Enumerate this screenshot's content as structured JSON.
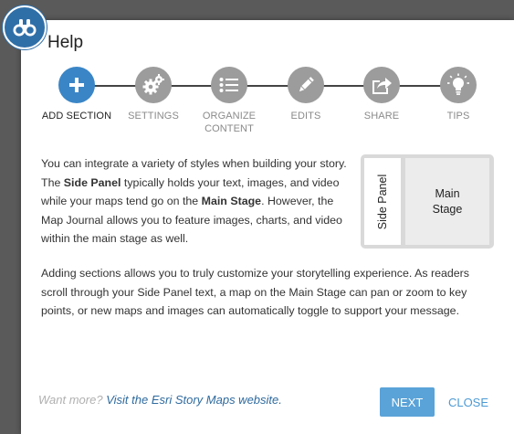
{
  "dialog": {
    "title": "Help",
    "logo_icon": "binoculars-icon"
  },
  "steps": [
    {
      "label": "ADD SECTION",
      "icon": "plus-icon",
      "active": true
    },
    {
      "label": "SETTINGS",
      "icon": "gears-icon",
      "active": false
    },
    {
      "label": "ORGANIZE\nCONTENT",
      "icon": "list-icon",
      "active": false
    },
    {
      "label": "EDITS",
      "icon": "pencil-icon",
      "active": false
    },
    {
      "label": "SHARE",
      "icon": "share-icon",
      "active": false
    },
    {
      "label": "TIPS",
      "icon": "lightbulb-icon",
      "active": false
    }
  ],
  "content": {
    "para1": {
      "t1": "You can integrate a variety of styles when building your story. The ",
      "b1": "Side Panel",
      "t2": " typically holds your text, images, and video while your maps tend go on the ",
      "b2": "Main Stage",
      "t3": ". However, the Map Journal allows you to feature images, charts, and video within the main stage as well."
    },
    "para2": "Adding sections allows you to truly customize your storytelling experience. As readers scroll through your Side Panel text, a map on the Main Stage can pan or zoom to key points, or new maps and images can automatically toggle to support your message."
  },
  "diagram": {
    "side_panel_label": "Side Panel",
    "main_stage_label": "Main\nStage"
  },
  "footer": {
    "prompt": "Want more?",
    "link_text": "Visit the Esri Story Maps website."
  },
  "buttons": {
    "next": "NEXT",
    "close": "CLOSE"
  },
  "colors": {
    "accent": "#3a85c6",
    "inactive_step": "#9c9c9c",
    "next_button": "#5aa3d8",
    "link": "#2e6a9e",
    "overlay": "#5a5a5a"
  }
}
